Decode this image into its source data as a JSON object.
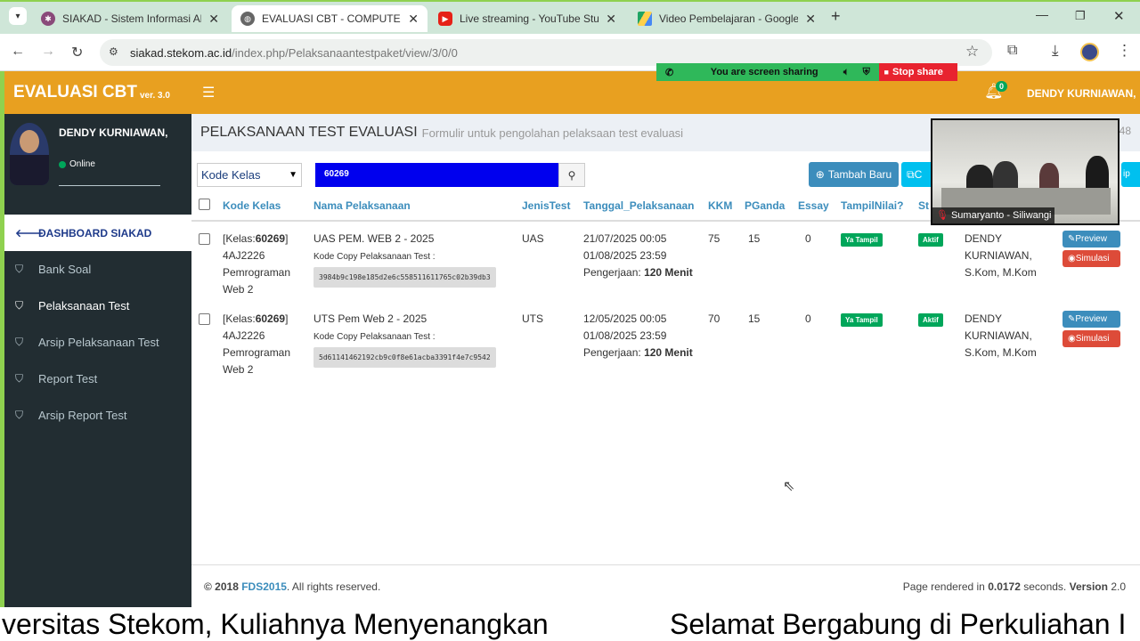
{
  "browser": {
    "tabs": [
      {
        "title": "SIAKAD - Sistem Informasi Akad",
        "favicon": "siakad-icon",
        "active": false
      },
      {
        "title": "EVALUASI CBT - COMPUTER BA",
        "favicon": "globe-icon",
        "active": true
      },
      {
        "title": "Live streaming - YouTube Studio",
        "favicon": "youtube-icon",
        "active": false
      },
      {
        "title": "Video Pembelajaran - Google D",
        "favicon": "google-drive-icon",
        "active": false
      }
    ],
    "url_host": "siakad.stekom.ac.id",
    "url_path": "/index.php/Pelaksanaantestpaket/view/3/0/0"
  },
  "share": {
    "text": "You are screen sharing",
    "stop": "Stop share"
  },
  "app": {
    "brand": "EVALUASI CBT",
    "version": "ver. 3.0",
    "notif_count": "0",
    "user_top": "DENDY KURNIAWAN,"
  },
  "sidebar": {
    "user_name": "DENDY KURNIAWAN,",
    "status": "Online",
    "items": [
      {
        "label": "DASHBOARD SIAKAD",
        "icon": "arrow-left-icon"
      },
      {
        "label": "Bank Soal",
        "icon": "bookmark-icon"
      },
      {
        "label": "Pelaksanaan Test",
        "icon": "bookmark-icon"
      },
      {
        "label": "Arsip Pelaksanaan Test",
        "icon": "bookmark-icon"
      },
      {
        "label": "Report Test",
        "icon": "bookmark-icon"
      },
      {
        "label": "Arsip Report Test",
        "icon": "bookmark-icon"
      }
    ]
  },
  "page": {
    "title": "PELAKSANAAN TEST EVALUASI",
    "subtitle": "Formulir untuk pengolahan pelaksaan test evaluasi",
    "partial_right": "48"
  },
  "filter": {
    "select_value": "Kode Kelas",
    "search_value": "60269",
    "add_button": "Tambah Baru",
    "partial_btn_a": "C",
    "partial_btn_b": "ip"
  },
  "table": {
    "headers": [
      "Kode Kelas",
      "Nama Pelaksanaan",
      "JenisTest",
      "Tanggal_Pelaksanaan",
      "KKM",
      "PGanda",
      "Essay",
      "TampilNilai?",
      "St"
    ],
    "copy_label": "Kode Copy Pelaksanaan Test :",
    "duration_label": "Pengerjaan:",
    "preview_label": "Preview",
    "simulasi_label": "Simulasi",
    "rows": [
      {
        "kelas_prefix": "[Kelas:",
        "kelas_code": "60269",
        "kelas_suffix": "]",
        "kelas_id": "4AJ2226",
        "kelas_name_1": "Pemrograman",
        "kelas_name_2": "Web 2",
        "nama": "UAS PEM. WEB 2 - 2025",
        "copy_code": "3984b9c198e185d2e6c558511611765c02b39db3",
        "jenis": "UAS",
        "tgl_start": "21/07/2025 00:05",
        "tgl_end": "01/08/2025 23:59",
        "durasi": "120 Menit",
        "kkm": "75",
        "pganda": "15",
        "essay": "0",
        "tampil": "Ya Tampil",
        "status": "Aktif",
        "pembuat_1": "DENDY",
        "pembuat_2": "KURNIAWAN,",
        "pembuat_3": "S.Kom, M.Kom"
      },
      {
        "kelas_prefix": "[Kelas:",
        "kelas_code": "60269",
        "kelas_suffix": "]",
        "kelas_id": "4AJ2226",
        "kelas_name_1": "Pemrograman",
        "kelas_name_2": "Web 2",
        "nama": "UTS Pem Web 2 - 2025",
        "copy_code": "5d61141462192cb9c0f8e61acba3391f4e7c9542",
        "jenis": "UTS",
        "tgl_start": "12/05/2025 00:05",
        "tgl_end": "01/08/2025 23:59",
        "durasi": "120 Menit",
        "kkm": "70",
        "pganda": "15",
        "essay": "0",
        "tampil": "Ya Tampil",
        "status": "Aktif",
        "pembuat_1": "DENDY",
        "pembuat_2": "KURNIAWAN,",
        "pembuat_3": "S.Kom, M.Kom"
      }
    ]
  },
  "footer": {
    "copy_prefix": "© 2018",
    "copy_link": "FDS2015",
    "copy_suffix": ". All rights reserved.",
    "rendered_prefix": "Page rendered in",
    "rendered_time": "0.0172",
    "rendered_mid": "seconds.",
    "version_label": "Version",
    "version": "2.0"
  },
  "video": {
    "caption": "Sumaryanto - Siliwangi"
  },
  "ticker": {
    "left": "versitas Stekom, Kuliahnya Menyenangkan",
    "right": "Selamat Bergabung di Perkuliahan I"
  }
}
